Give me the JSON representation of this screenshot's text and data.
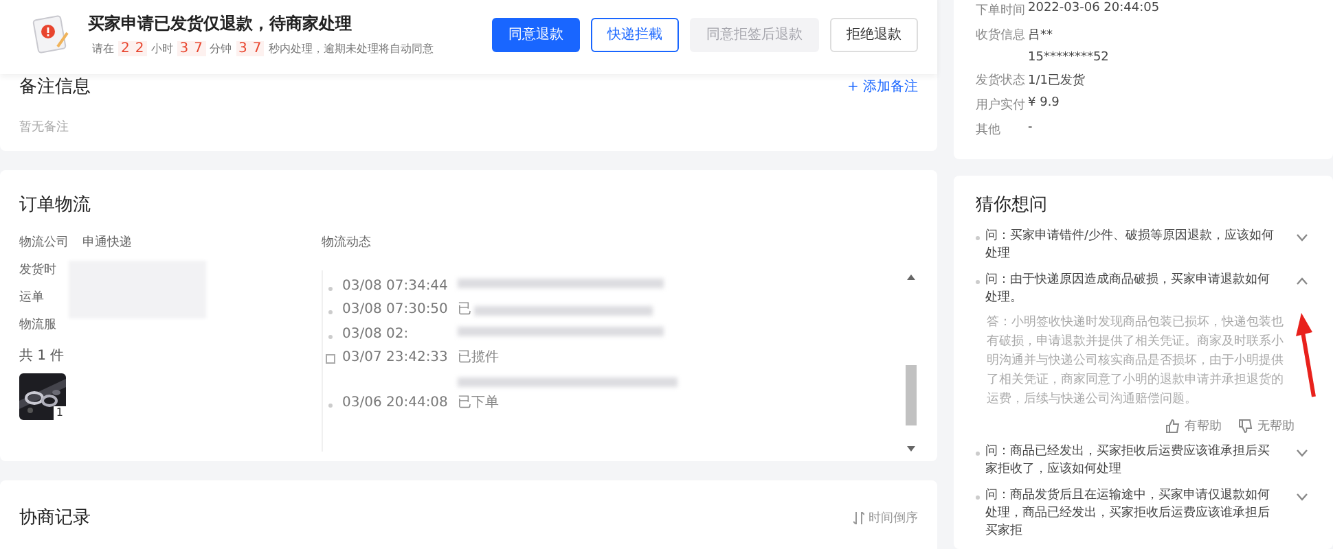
{
  "header": {
    "title": "买家申请已发货仅退款，待商家处理",
    "countdown": [
      {
        "kind": "text",
        "text": "请在"
      },
      {
        "kind": "digit",
        "text": "2"
      },
      {
        "kind": "digit",
        "text": "2"
      },
      {
        "kind": "text",
        "text": "小时"
      },
      {
        "kind": "digit",
        "text": "3"
      },
      {
        "kind": "digit",
        "text": "7"
      },
      {
        "kind": "text",
        "text": "分钟"
      },
      {
        "kind": "digit",
        "text": "3"
      },
      {
        "kind": "digit",
        "text": "7"
      },
      {
        "kind": "text",
        "text": "秒内处理，逾期未处理将自动同意"
      }
    ],
    "buttons": [
      {
        "label": "同意退款",
        "kind": "primary",
        "disabled": false
      },
      {
        "label": "快递拦截",
        "kind": "outline",
        "disabled": false
      },
      {
        "label": "同意拒签后退款",
        "kind": "default",
        "disabled": true
      },
      {
        "label": "拒绝退款",
        "kind": "default",
        "disabled": false
      }
    ]
  },
  "remarks": {
    "title": "备注信息",
    "add_link": "+ 添加备注",
    "empty": "暂无备注"
  },
  "logistics": {
    "title": "订单物流",
    "fields": [
      {
        "label": "物流公司",
        "value": "申通快递"
      },
      {
        "label": "发货时"
      },
      {
        "label": "运单"
      },
      {
        "label": "物流服"
      }
    ],
    "count": "共 1 件",
    "item_qty": "1",
    "track_title": "物流动态",
    "track": [
      {
        "time": "03/08 07:34:44",
        "kind": "dot",
        "lines": [
          {
            "kind": "blurred"
          }
        ]
      },
      {
        "time": "03/08 07:30:50",
        "kind": "dot",
        "lines": [
          {
            "kind": "text",
            "text": "已"
          },
          {
            "kind": "blurred"
          }
        ]
      },
      {
        "time": "03/08 02:",
        "kind": "dot",
        "lines": [
          {
            "kind": "blurred"
          }
        ]
      },
      {
        "time": "03/07 23:42:33",
        "kind": "box",
        "lines": [
          {
            "kind": "text",
            "text": "已揽件"
          },
          {
            "kind": "blurred"
          }
        ]
      },
      {
        "time": "03/06 20:44:08",
        "kind": "dot",
        "lines": [
          {
            "kind": "text",
            "text": "已下单"
          }
        ]
      }
    ]
  },
  "negotiation": {
    "title": "协商记录",
    "sort": "时间倒序"
  },
  "order_info": [
    {
      "label": "下单时间",
      "values": [
        "2022-03-06 20:44:05"
      ]
    },
    {
      "label": "收货信息",
      "values": [
        "吕** ",
        "15********52"
      ]
    },
    {
      "label": "发货状态",
      "values": [
        "1/1已发货"
      ]
    },
    {
      "label": "用户实付",
      "values": [
        "¥ 9.9"
      ]
    },
    {
      "label": "其他",
      "values": [
        "-"
      ]
    }
  ],
  "faq": {
    "title": "猜你想问",
    "items": [
      {
        "question": "问：买家申请错件/少件、破损等原因退款，应该如何处理",
        "expanded": false
      },
      {
        "question": "问：由于快递原因造成商品破损，买家申请退款如何处理。",
        "expanded": true,
        "answer": "答：小明签收快递时发现商品包装已损坏，快递包装也有破损，申请退款并提供了相关凭证。商家及时联系小明沟通并与快递公司核实商品是否损坏，由于小明提供了相关凭证，商家同意了小明的退款申请并承担退货的运费，后续与快递公司沟通赔偿问题。",
        "helpful": "有帮助",
        "unhelpful": "无帮助"
      },
      {
        "question": "问：商品已经发出，买家拒收后运费应该谁承担后买家拒收了，应该如何处理",
        "expanded": false
      },
      {
        "question": "问：商品发货后且在运输途中，买家申请仅退款如何处理，商品已经发出，买家拒收后运费应该谁承担后买家拒",
        "expanded": false
      }
    ]
  }
}
